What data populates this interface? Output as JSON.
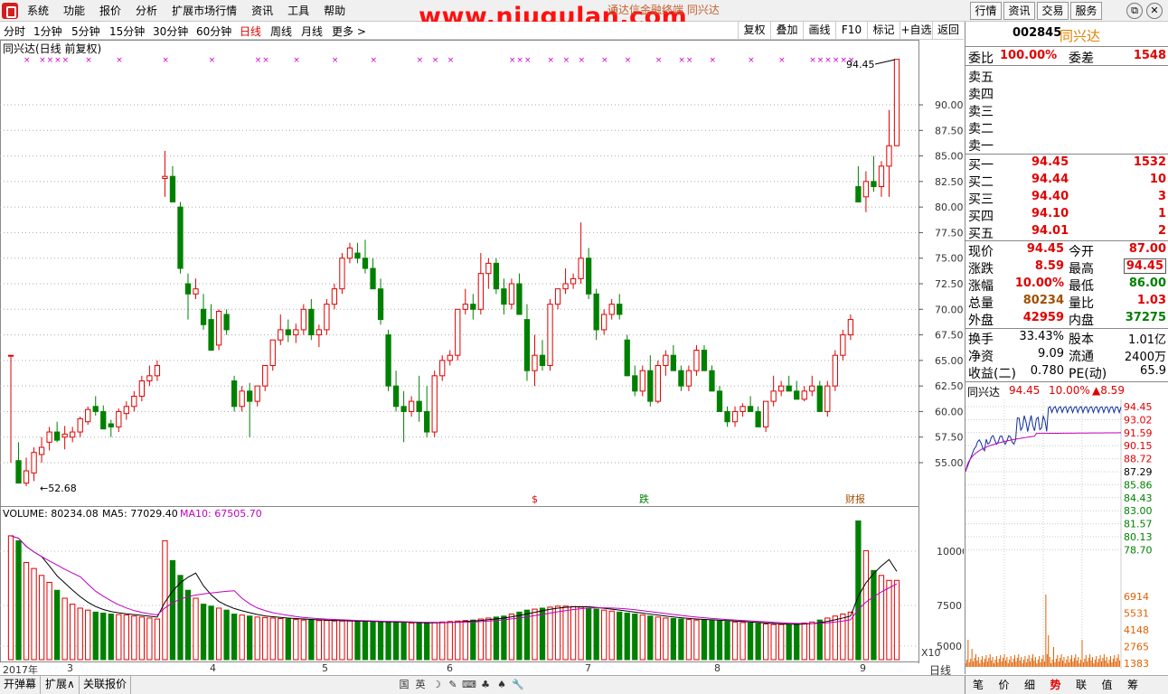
{
  "watermark": "www.niugulan.com",
  "window_title": "通达信金融终端  同兴达",
  "menu": [
    "系统",
    "功能",
    "报价",
    "分析",
    "扩展市场行情",
    "资讯",
    "工具",
    "帮助"
  ],
  "top_buttons": [
    "行情",
    "资讯",
    "交易",
    "服务"
  ],
  "periods": [
    "分时",
    "1分钟",
    "5分钟",
    "15分钟",
    "30分钟",
    "60分钟",
    "日线",
    "周线",
    "月线",
    "更多 >"
  ],
  "active_period": "日线",
  "toolbar": [
    "复权",
    "叠加",
    "画线",
    "F10",
    "标记",
    "+自选",
    "返回"
  ],
  "chart_title": "同兴达(日线 前复权)",
  "price_axis": [
    "90.00",
    "87.50",
    "85.00",
    "82.50",
    "80.00",
    "77.50",
    "75.00",
    "72.50",
    "70.00",
    "67.50",
    "65.00",
    "62.50",
    "60.00",
    "57.50",
    "55.00"
  ],
  "high_label": "94.45",
  "low_label": "52.68",
  "event_markers": [
    "$",
    "跌",
    "财报"
  ],
  "volume_info": {
    "volume": "VOLUME: 80234.08",
    "ma5": "MA5: 77029.40",
    "ma10": "MA10: 67505.70"
  },
  "volume_axis": [
    "10000",
    "7500",
    "5000"
  ],
  "volume_unit": "X10",
  "date_axis": [
    "2017年",
    "3",
    "4",
    "5",
    "6",
    "7",
    "8",
    "9"
  ],
  "period_label": "日线",
  "bottom_tabs": [
    "开弹幕",
    "扩展∧",
    "关联报价"
  ],
  "bottom_icons": [
    "国",
    "英",
    "☽",
    "✎",
    "⌨",
    "♣",
    "♠",
    "🔧"
  ],
  "right_tabs": [
    "笔",
    "价",
    "细",
    "势",
    "联",
    "值",
    "筹"
  ],
  "active_right_tab": "势",
  "stock": {
    "code": "002845",
    "name": "同兴达",
    "weibi_label": "委比",
    "weibi": "100.00%",
    "weicha_label": "委差",
    "weicha": "1548",
    "sells": [
      "卖五",
      "卖四",
      "卖三",
      "卖二",
      "卖一"
    ],
    "buys": [
      {
        "label": "买一",
        "price": "94.45",
        "vol": "1532"
      },
      {
        "label": "买二",
        "price": "94.44",
        "vol": "10"
      },
      {
        "label": "买三",
        "price": "94.40",
        "vol": "3"
      },
      {
        "label": "买四",
        "price": "94.10",
        "vol": "1"
      },
      {
        "label": "买五",
        "price": "94.01",
        "vol": "2"
      }
    ],
    "quote": [
      {
        "l1": "现价",
        "v1": "94.45",
        "l2": "今开",
        "v2": "87.00"
      },
      {
        "l1": "涨跌",
        "v1": "8.59",
        "l2": "最高",
        "v2": "94.45"
      },
      {
        "l1": "涨幅",
        "v1": "10.00%",
        "l2": "最低",
        "v2": "86.00"
      },
      {
        "l1": "总量",
        "v1": "80234",
        "l2": "量比",
        "v2": "1.03"
      },
      {
        "l1": "外盘",
        "v1": "42959",
        "l2": "内盘",
        "v2": "37275"
      }
    ],
    "fund": [
      {
        "l1": "换手",
        "v1": "33.43%",
        "l2": "股本",
        "v2": "1.01亿"
      },
      {
        "l1": "净资",
        "v1": "9.09",
        "l2": "流通",
        "v2": "2400万"
      },
      {
        "l1": "收益(二)",
        "v1": "0.780",
        "l2": "PE(动)",
        "v2": "65.9"
      }
    ],
    "mini_header": {
      "name": "同兴达",
      "price": "94.45",
      "pct": "10.00%",
      "chg": "▲8.59"
    },
    "mini_axis": [
      "94.45",
      "93.02",
      "91.59",
      "90.15",
      "88.72",
      "87.29",
      "85.86",
      "84.43",
      "83.00",
      "81.57",
      "80.13",
      "78.70"
    ],
    "mini_vol_axis": [
      "6914",
      "5531",
      "4148",
      "2765",
      "1383"
    ]
  },
  "colors": {
    "up": "#e00000",
    "down": "#008000",
    "ma5": "#000000",
    "ma10": "#c000c0"
  },
  "chart_data": {
    "type": "candlestick",
    "title": "同兴达(日线 前复权)",
    "ylim": [
      52.68,
      94.45
    ],
    "candles": [
      [
        65.5,
        65.5,
        55.0,
        65.5,
        1250
      ],
      [
        55.2,
        57.0,
        53.0,
        53.0,
        1200
      ],
      [
        53.0,
        55.5,
        52.7,
        54.2,
        980
      ],
      [
        54.0,
        56.5,
        53.2,
        56.0,
        920
      ],
      [
        55.8,
        57.5,
        55.0,
        56.5,
        850
      ],
      [
        57.0,
        58.5,
        56.2,
        58.0,
        780
      ],
      [
        58.0,
        59.0,
        57.0,
        57.2,
        700
      ],
      [
        57.5,
        58.6,
        56.3,
        57.8,
        620
      ],
      [
        57.5,
        58.5,
        57.0,
        58.0,
        560
      ],
      [
        58.0,
        59.5,
        57.5,
        59.3,
        520
      ],
      [
        59.0,
        60.5,
        58.7,
        60.2,
        500
      ],
      [
        60.5,
        61.5,
        59.6,
        60.0,
        480
      ],
      [
        60.0,
        60.6,
        58.5,
        58.3,
        470
      ],
      [
        58.8,
        59.2,
        57.5,
        58.5,
        460
      ],
      [
        58.5,
        60.3,
        58.0,
        60.0,
        455
      ],
      [
        59.8,
        61.0,
        59.2,
        60.5,
        450
      ],
      [
        60.5,
        62.0,
        60.0,
        61.5,
        440
      ],
      [
        61.5,
        63.5,
        61.0,
        63.0,
        430
      ],
      [
        63.0,
        64.5,
        62.5,
        63.5,
        420
      ],
      [
        63.5,
        65.0,
        63.0,
        64.5,
        410
      ],
      [
        82.8,
        85.5,
        81.0,
        83.0,
        1200
      ],
      [
        83.0,
        84.0,
        80.5,
        80.5,
        1000
      ],
      [
        80.0,
        80.5,
        73.5,
        74.0,
        850
      ],
      [
        72.5,
        73.5,
        69.0,
        71.5,
        700
      ],
      [
        71.5,
        73.0,
        71.0,
        72.0,
        620
      ],
      [
        70.0,
        71.5,
        68.0,
        68.5,
        560
      ],
      [
        69.0,
        70.5,
        66.0,
        66.0,
        540
      ],
      [
        66.5,
        70.0,
        66.0,
        69.8,
        520
      ],
      [
        69.5,
        70.0,
        67.5,
        68.0,
        500
      ],
      [
        63.0,
        63.5,
        60.0,
        60.5,
        460
      ],
      [
        60.5,
        62.5,
        60.0,
        62.0,
        450
      ],
      [
        62.0,
        62.8,
        57.5,
        61.0,
        440
      ],
      [
        61.0,
        62.5,
        60.5,
        62.5,
        430
      ],
      [
        62.5,
        64.5,
        62.0,
        64.5,
        425
      ],
      [
        64.5,
        67.0,
        64.0,
        67.0,
        420
      ],
      [
        67.0,
        69.5,
        66.5,
        68.0,
        415
      ],
      [
        68.0,
        69.0,
        66.8,
        67.5,
        410
      ],
      [
        67.5,
        68.6,
        66.7,
        68.0,
        405
      ],
      [
        68.0,
        70.5,
        67.5,
        70.0,
        400
      ],
      [
        70.0,
        71.0,
        67.0,
        67.5,
        400
      ],
      [
        67.5,
        68.5,
        66.3,
        68.0,
        395
      ],
      [
        68.0,
        71.0,
        67.5,
        70.5,
        395
      ],
      [
        70.5,
        72.5,
        70.0,
        72.0,
        390
      ],
      [
        72.0,
        75.5,
        71.5,
        75.0,
        390
      ],
      [
        75.0,
        76.5,
        74.5,
        76.0,
        390
      ],
      [
        75.5,
        76.5,
        74.5,
        75.0,
        385
      ],
      [
        75.0,
        76.8,
        73.5,
        74.0,
        385
      ],
      [
        74.0,
        75.0,
        72.5,
        72.0,
        380
      ],
      [
        72.0,
        73.0,
        68.5,
        69.0,
        380
      ],
      [
        67.5,
        68.0,
        62.0,
        62.5,
        380
      ],
      [
        62.5,
        64.0,
        60.0,
        60.5,
        375
      ],
      [
        60.5,
        62.0,
        57.0,
        60.0,
        375
      ],
      [
        60.0,
        61.5,
        59.5,
        61.0,
        370
      ],
      [
        61.0,
        63.5,
        59.0,
        60.0,
        370
      ],
      [
        60.0,
        62.5,
        57.5,
        58.0,
        370
      ],
      [
        58.0,
        64.0,
        57.5,
        63.5,
        375
      ],
      [
        63.5,
        65.5,
        63.0,
        65.0,
        380
      ],
      [
        65.0,
        66.0,
        64.5,
        65.5,
        385
      ],
      [
        65.5,
        70.0,
        65.0,
        70.0,
        390
      ],
      [
        70.0,
        72.0,
        69.5,
        70.5,
        395
      ],
      [
        70.5,
        71.5,
        69.0,
        70.0,
        400
      ],
      [
        70.0,
        75.5,
        69.5,
        73.5,
        410
      ],
      [
        73.5,
        75.0,
        72.0,
        74.5,
        420
      ],
      [
        74.5,
        75.0,
        71.5,
        72.0,
        430
      ],
      [
        72.0,
        73.0,
        69.5,
        70.5,
        440
      ],
      [
        70.5,
        73.0,
        70.0,
        72.5,
        460
      ],
      [
        72.5,
        73.5,
        70.5,
        69.5,
        480
      ],
      [
        69.0,
        70.5,
        63.0,
        64.0,
        500
      ],
      [
        64.0,
        67.5,
        62.5,
        65.5,
        510
      ],
      [
        65.5,
        67.0,
        64.0,
        64.5,
        520
      ],
      [
        64.5,
        71.0,
        64.0,
        70.5,
        530
      ],
      [
        70.5,
        72.0,
        70.0,
        72.0,
        540
      ],
      [
        72.0,
        74.0,
        71.5,
        72.5,
        540
      ],
      [
        72.5,
        73.5,
        72.0,
        73.0,
        535
      ],
      [
        73.0,
        78.5,
        72.5,
        75.0,
        530
      ],
      [
        75.0,
        76.0,
        71.0,
        71.5,
        520
      ],
      [
        71.5,
        72.0,
        67.0,
        68.0,
        510
      ],
      [
        68.0,
        70.0,
        67.5,
        69.5,
        500
      ],
      [
        69.5,
        71.0,
        69.0,
        70.5,
        490
      ],
      [
        70.5,
        71.5,
        69.0,
        69.5,
        480
      ],
      [
        67.0,
        67.5,
        63.5,
        63.5,
        470
      ],
      [
        63.5,
        64.5,
        61.5,
        62.0,
        460
      ],
      [
        62.0,
        64.5,
        61.5,
        64.0,
        450
      ],
      [
        64.0,
        65.5,
        60.5,
        61.0,
        440
      ],
      [
        61.0,
        65.0,
        60.8,
        64.5,
        430
      ],
      [
        64.5,
        66.0,
        63.5,
        65.5,
        420
      ],
      [
        65.5,
        66.5,
        64.0,
        64.0,
        415
      ],
      [
        64.0,
        64.5,
        62.0,
        62.5,
        410
      ],
      [
        62.5,
        64.5,
        62.0,
        64.0,
        405
      ],
      [
        64.0,
        66.5,
        63.5,
        66.0,
        400
      ],
      [
        66.0,
        66.5,
        64.0,
        64.0,
        400
      ],
      [
        64.0,
        64.5,
        62.0,
        62.0,
        395
      ],
      [
        62.0,
        62.5,
        60.0,
        60.0,
        390
      ],
      [
        60.0,
        60.5,
        58.5,
        59.0,
        385
      ],
      [
        59.0,
        60.5,
        58.5,
        60.0,
        380
      ],
      [
        60.0,
        60.8,
        59.5,
        60.5,
        375
      ],
      [
        60.5,
        61.5,
        60.0,
        60.0,
        370
      ],
      [
        60.0,
        60.5,
        58.5,
        58.5,
        365
      ],
      [
        58.5,
        61.0,
        58.0,
        61.0,
        360
      ],
      [
        61.0,
        63.5,
        60.5,
        62.0,
        355
      ],
      [
        62.0,
        63.0,
        61.5,
        62.5,
        355
      ],
      [
        62.5,
        63.5,
        62.0,
        62.0,
        355
      ],
      [
        62.0,
        63.0,
        61.5,
        61.2,
        360
      ],
      [
        61.2,
        62.5,
        61.0,
        62.0,
        370
      ],
      [
        62.0,
        63.5,
        61.5,
        62.5,
        380
      ],
      [
        62.5,
        63.0,
        60.0,
        60.0,
        400
      ],
      [
        60.0,
        63.0,
        59.5,
        62.5,
        420
      ],
      [
        62.5,
        66.0,
        62.0,
        65.5,
        440
      ],
      [
        65.5,
        68.0,
        65.0,
        67.5,
        460
      ],
      [
        67.5,
        69.5,
        67.0,
        69.0,
        480
      ],
      [
        82.0,
        84.0,
        80.5,
        80.5,
        1400
      ],
      [
        81.0,
        83.5,
        79.5,
        82.5,
        1100
      ],
      [
        82.5,
        85.0,
        81.5,
        82.0,
        900
      ],
      [
        82.0,
        84.5,
        81.0,
        84.0,
        850
      ],
      [
        84.0,
        89.5,
        81.0,
        86.0,
        800
      ],
      [
        86.0,
        94.45,
        86.0,
        94.45,
        800
      ]
    ],
    "ma5": "MA5",
    "ma10": "MA10",
    "date_ticks": [
      "2017年",
      "3",
      "4",
      "5",
      "6",
      "7",
      "8",
      "9"
    ]
  }
}
